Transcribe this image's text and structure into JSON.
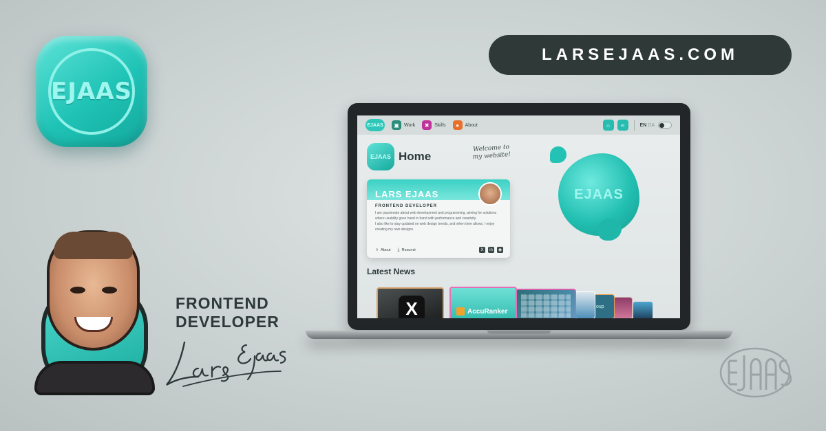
{
  "brand": {
    "emblem_text": "EJAAS",
    "url": "LARSEJAAS.COM",
    "role_line1": "FRONTEND",
    "role_line2": "DEVELOPER",
    "signature": "Lars Ejaas"
  },
  "colors": {
    "accent": "#1fc3b6",
    "pill": "#2f3a38",
    "text": "#2e3a3a"
  },
  "site": {
    "nav": {
      "logo": "EJAAS",
      "items": [
        {
          "label": "Work",
          "icon": "briefcase-icon"
        },
        {
          "label": "Skills",
          "icon": "tools-icon"
        },
        {
          "label": "About",
          "icon": "person-card-icon"
        }
      ],
      "lang_en": "EN",
      "lang_da": "DA"
    },
    "home_logo": "EJAAS",
    "home_title": "Home",
    "welcome_line1": "Welcome to",
    "welcome_line2": "my website!",
    "blob_text": "EJAAS",
    "card": {
      "name": "LARS EJAAS",
      "role": "FRONTEND DEVELOPER",
      "bio_1": "I am passionate about web development and programming, aiming for solutions where usability goes hand in hand with performance and creativity.",
      "bio_2": "I also like to stay updated on web design trends, and when time allows, I enjoy creating my own designs.",
      "about_label": "About",
      "resume_label": "Resumé",
      "socials": [
        "x-icon",
        "linkedin-icon",
        "github-icon"
      ]
    },
    "news_title": "Latest News",
    "news": {
      "x_glyph": "X",
      "accuranker_label": "AccuRanker",
      "group_label": "oup"
    }
  }
}
